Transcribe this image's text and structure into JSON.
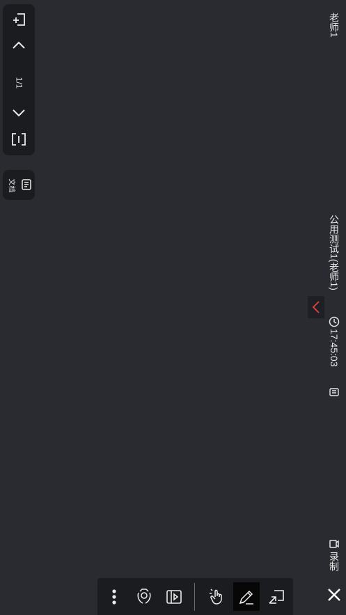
{
  "left_panel": {
    "page_indicator": "1/1",
    "icons": [
      "add-page-icon",
      "chevron-up-icon",
      "chevron-down-icon",
      "fit-screen-icon"
    ]
  },
  "doc_panel": {
    "label": "文档",
    "icon": "document-icon"
  },
  "right_bar": {
    "teacher_name": "老师1",
    "class_title": "公用测试1(老师1)",
    "clock": "17:45:03",
    "record_label": "录制",
    "accent_color": "#e0443c"
  },
  "bottom_toolbar": {
    "tools": [
      {
        "name": "more-icon",
        "active": false
      },
      {
        "name": "camera-flip-icon",
        "active": false
      },
      {
        "name": "media-icon",
        "active": false
      },
      {
        "name": "pointer-hand-icon",
        "active": false
      },
      {
        "name": "pencil-icon",
        "active": true
      },
      {
        "name": "screen-share-icon",
        "active": false
      }
    ],
    "close_icon": "close-icon"
  }
}
